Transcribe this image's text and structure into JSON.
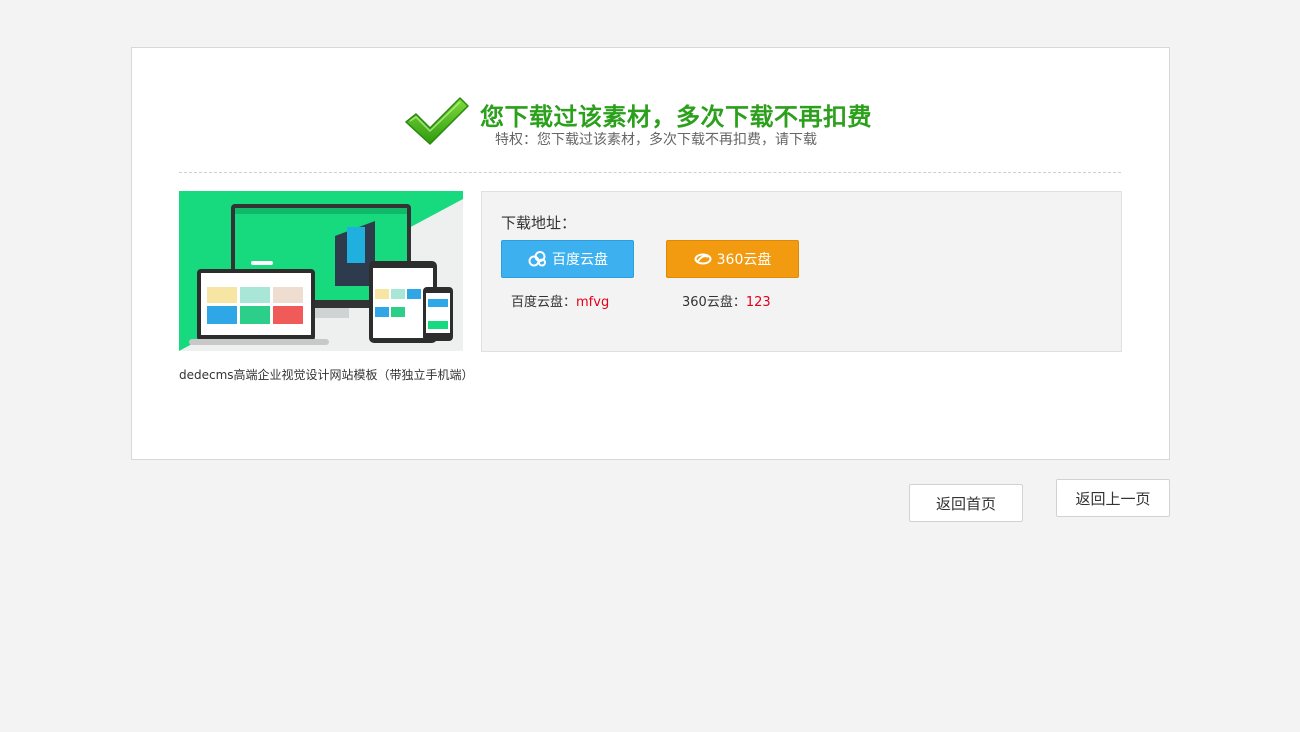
{
  "header": {
    "title": "您下载过该素材，多次下载不再扣费",
    "subtitle": "特权：您下载过该素材，多次下载不再扣费，请下载",
    "icon": "checkmark-icon",
    "accent_color": "#2ca01c"
  },
  "product": {
    "image_icon": "template-preview-image",
    "caption": "dedecms高端企业视觉设计网站模板（带独立手机端）"
  },
  "download": {
    "label": "下载地址：",
    "baidu": {
      "button_label": "百度云盘",
      "icon": "baidu-cloud-icon",
      "code_label": "百度云盘：",
      "code": "mfvg",
      "color": "#3db0ef"
    },
    "yun360": {
      "button_label": "360云盘",
      "icon": "cloud-360-icon",
      "code_label": "360云盘：",
      "code": "123",
      "color": "#f29a10"
    }
  },
  "nav": {
    "home_label": "返回首页",
    "back_label": "返回上一页"
  }
}
